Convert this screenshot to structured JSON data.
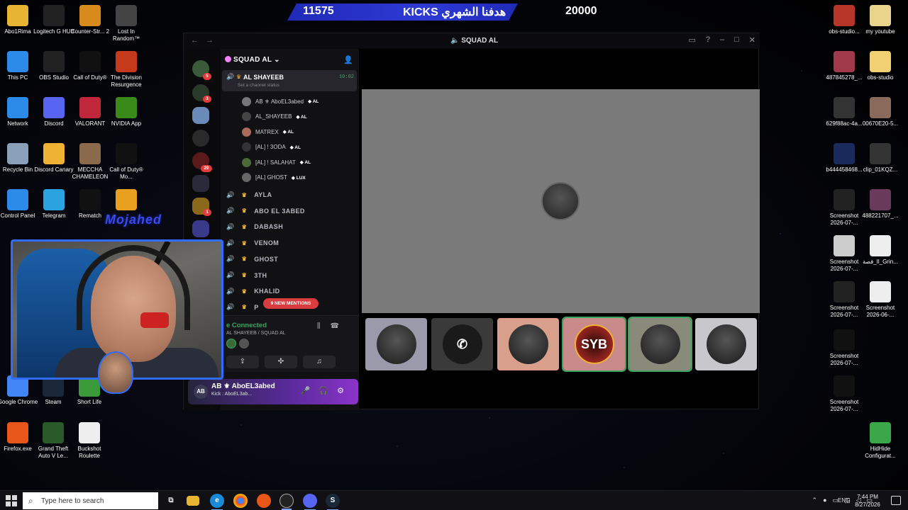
{
  "banner": {
    "left_number": "11575",
    "center_text": "هدفنا الشهري KICKS",
    "right_number": "20000"
  },
  "overlay": {
    "streamer_name": "Mojahed"
  },
  "desktop_left": [
    {
      "label": "Abo1Rima",
      "icon": "folder-icon",
      "color": "#e8b434"
    },
    {
      "label": "Logitech G HUB",
      "icon": "logitech-icon",
      "color": "#222"
    },
    {
      "label": "Counter-Str... 2",
      "icon": "cs2-icon",
      "color": "#d98a1c"
    },
    {
      "label": "Lost In Random™",
      "icon": "game-icon",
      "color": "#444"
    },
    {
      "label": "This PC",
      "icon": "computer-icon",
      "color": "#2c8ae8"
    },
    {
      "label": "OBS Studio",
      "icon": "obs-icon",
      "color": "#222"
    },
    {
      "label": "Call of Duty®",
      "icon": "cod-icon",
      "color": "#111"
    },
    {
      "label": "The Division Resurgence",
      "icon": "division-icon",
      "color": "#c43a1a"
    },
    {
      "label": "Network",
      "icon": "network-icon",
      "color": "#2c8ae8"
    },
    {
      "label": "Discord",
      "icon": "discord-icon",
      "color": "#5865f2"
    },
    {
      "label": "VALORANT",
      "icon": "valorant-icon",
      "color": "#c0273a"
    },
    {
      "label": "NVIDIA App",
      "icon": "nvidia-icon",
      "color": "#3a8a1a"
    },
    {
      "label": "Recycle Bin",
      "icon": "recycle-bin-icon",
      "color": "#8aa0b8"
    },
    {
      "label": "Discord Canary",
      "icon": "discord-canary-icon",
      "color": "#f0b232"
    },
    {
      "label": "MECCHA CHAMELEON",
      "icon": "game-icon",
      "color": "#8a6a4a"
    },
    {
      "label": "Call of Duty® Mo...",
      "icon": "cod-icon",
      "color": "#111"
    },
    {
      "label": "Control Panel",
      "icon": "control-panel-icon",
      "color": "#2c8ae8"
    },
    {
      "label": "Telegram",
      "icon": "telegram-icon",
      "color": "#2aa3e0"
    },
    {
      "label": "Rematch",
      "icon": "rematch-icon",
      "color": "#111"
    },
    {
      "label": "",
      "icon": "game-icon",
      "color": "#e8a020"
    },
    {
      "label": "Google Chrome",
      "icon": "chrome-icon",
      "color": "#4285f4"
    },
    {
      "label": "Steam",
      "icon": "steam-icon",
      "color": "#1b2838"
    },
    {
      "label": "Short Life",
      "icon": "game-icon",
      "color": "#3a9a3a"
    },
    {
      "label": "Firefox.exe",
      "icon": "firefox-icon",
      "color": "#e8561a"
    },
    {
      "label": "Grand Theft Auto V Le...",
      "icon": "gta-icon",
      "color": "#2a5a2a"
    },
    {
      "label": "Buckshot Roulette",
      "icon": "file-icon",
      "color": "#eee"
    }
  ],
  "desktop_right": [
    {
      "label": "obs-studio...",
      "icon": "archive-icon",
      "color": "#b8352a"
    },
    {
      "label": "my youtube",
      "icon": "file-icon",
      "color": "#e8d48a"
    },
    {
      "label": "487845278_...",
      "icon": "image-icon",
      "color": "#a03a4a"
    },
    {
      "label": "obs-studio",
      "icon": "folder-icon",
      "color": "#f0d070"
    },
    {
      "label": "629f88ac-4a...",
      "icon": "image-icon",
      "color": "#333"
    },
    {
      "label": "00670E20-5...",
      "icon": "image-icon",
      "color": "#8a6a5a"
    },
    {
      "label": "b444458468...",
      "icon": "image-icon",
      "color": "#1a2a5a"
    },
    {
      "label": "clip_01KQZ...",
      "icon": "image-icon",
      "color": "#333"
    },
    {
      "label": "Screenshot 2026-07-...",
      "icon": "image-icon",
      "color": "#222"
    },
    {
      "label": "488221707_...",
      "icon": "image-icon",
      "color": "#6a3a5a"
    },
    {
      "label": "Screenshot 2026-07-...",
      "icon": "image-icon",
      "color": "#ccc"
    },
    {
      "label": "قصة_Il_Grin...",
      "icon": "video-icon",
      "color": "#eee"
    },
    {
      "label": "Screenshot 2026-07-...",
      "icon": "image-icon",
      "color": "#222"
    },
    {
      "label": "Screenshot 2026-06-...",
      "icon": "image-icon",
      "color": "#eee"
    },
    {
      "label": "Screenshot 2026-07-...",
      "icon": "image-icon",
      "color": "#111"
    },
    {
      "label": "Screenshot 2026-07-...",
      "icon": "image-icon",
      "color": "#111"
    },
    {
      "label": "HidHide Configurat...",
      "icon": "hidhide-icon",
      "color": "#3aa84a"
    }
  ],
  "discord": {
    "window_title": "SQUAD AL",
    "server_name": "SQUAD AL",
    "active_channel": {
      "name": "AL SHAYEEB",
      "time": "10:02",
      "status": "Set a channel status"
    },
    "members": [
      {
        "name": "AB ⚜ AboEL3abed",
        "tag": "AL",
        "color": "#777"
      },
      {
        "name": "AL_SHAYEEB",
        "tag": "AL",
        "color": "#444"
      },
      {
        "name": "MATREX",
        "tag": "AL",
        "color": "#a86a5a"
      },
      {
        "name": "[AL] ! 3ODA",
        "tag": "AL",
        "color": "#333"
      },
      {
        "name": "[AL] ! SALAHAT",
        "tag": "AL",
        "color": "#4a6a3a"
      },
      {
        "name": "[AL] GHOST",
        "tag": "LUX",
        "color": "#666"
      }
    ],
    "voice_channels": [
      "AYLA",
      "ABO EL 3ABED",
      "DABASH",
      "VENOM",
      "GHOST",
      "3TH",
      "KHALID",
      "P"
    ],
    "mentions_badge": "9 NEW MENTIONS",
    "voice_panel": {
      "status": "e Connected",
      "sub": "AL SHAYEEB / SQUAD AL"
    },
    "user": {
      "name": "AB ⚜ AboEL3abed",
      "status": "Kick : AboEL3ab..."
    },
    "tiles": [
      {
        "color": "#9a9aaa",
        "icon": "avatar"
      },
      {
        "color": "#3a3a3a",
        "icon": "phone-icon"
      },
      {
        "color": "#d8a08a",
        "icon": "avatar"
      },
      {
        "color": "#c88a8a",
        "icon": "syb-logo"
      },
      {
        "color": "#8a8a7a",
        "icon": "avatar"
      },
      {
        "color": "#c8c8cc",
        "icon": "avatar"
      }
    ]
  },
  "taskbar": {
    "search_placeholder": "Type here to search",
    "lang": "ENG",
    "time": "7:44 PM",
    "date": "8/27/2026"
  }
}
